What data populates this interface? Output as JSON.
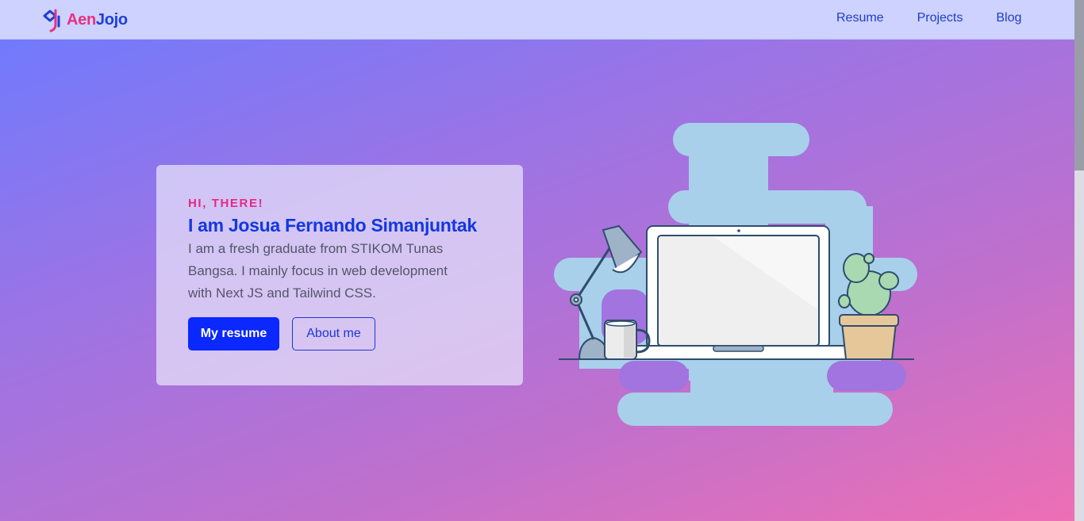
{
  "brand": {
    "part1": "Aen",
    "part2": "Jojo"
  },
  "nav": {
    "items": [
      {
        "label": "Resume"
      },
      {
        "label": "Projects"
      },
      {
        "label": "Blog"
      }
    ]
  },
  "hero": {
    "greeting": "HI, THERE!",
    "name": "I am Josua Fernando Simanjuntak",
    "bio": "I am a fresh graduate from STIKOM Tunas Bangsa. I mainly focus in web development with Next JS and Tailwind CSS.",
    "primary_button": "My resume",
    "secondary_button": "About me"
  },
  "colors": {
    "accent_pink": "#e32a85",
    "accent_blue": "#1238e0",
    "primary_button": "#0a28ff",
    "navbar_bg": "#cdd2ff"
  },
  "icons": {
    "logo": "aenjojo-logo-icon",
    "illustration": "laptop-desk-illustration"
  }
}
